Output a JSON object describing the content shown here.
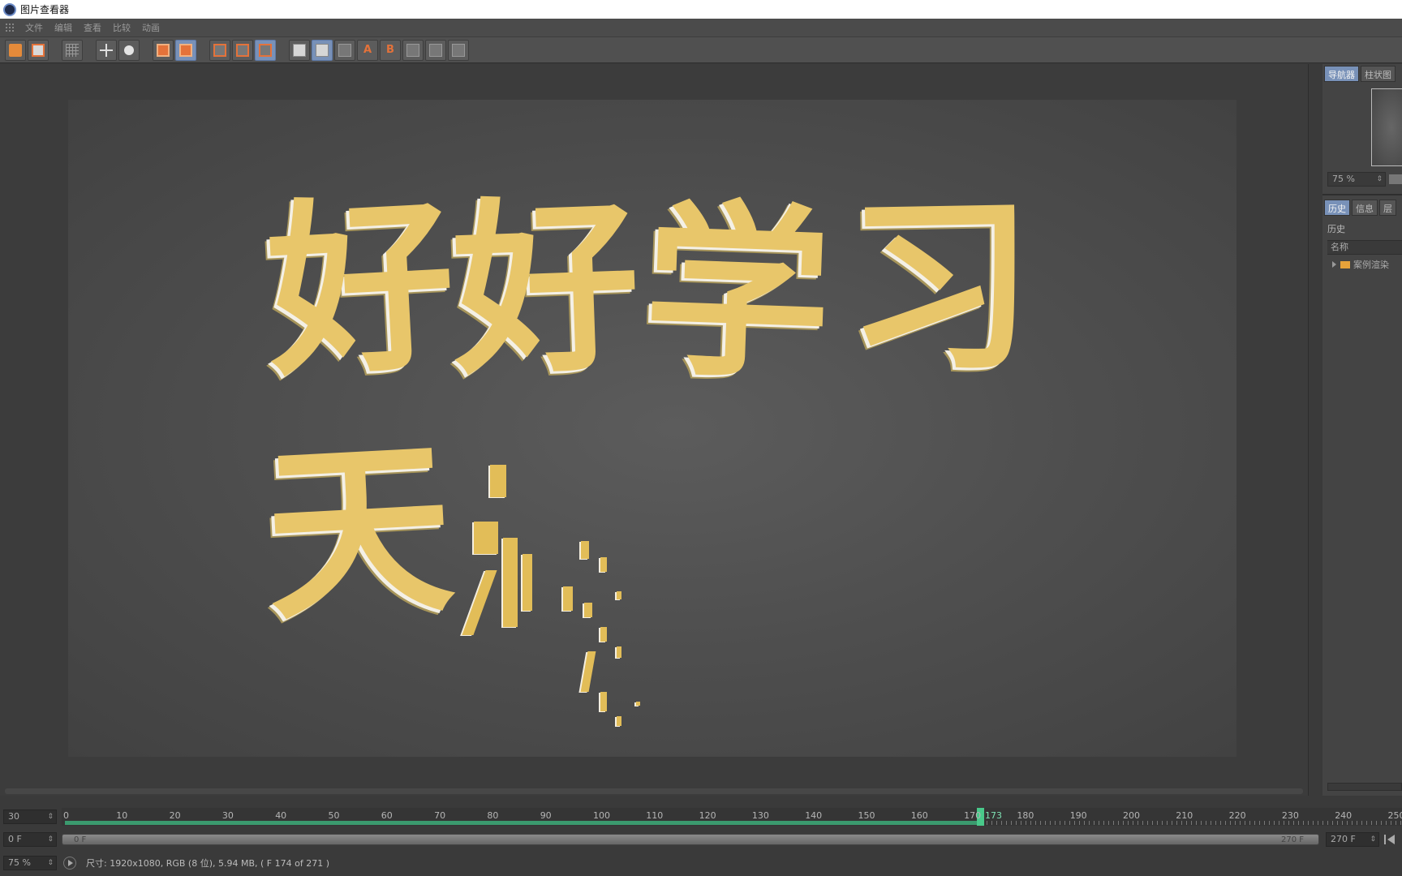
{
  "window": {
    "title": "图片查看器"
  },
  "menu": [
    "文件",
    "编辑",
    "查看",
    "比较",
    "动画"
  ],
  "canvas": {
    "text_line1": [
      "好",
      "好",
      "学",
      "习"
    ],
    "text_line2": "天",
    "text_color": "#e8c66a"
  },
  "right_panel": {
    "top_tabs": [
      "导航器",
      "柱状图"
    ],
    "zoom": "75 %",
    "bottom_tabs": [
      "历史",
      "信息",
      "层"
    ],
    "history_title": "历史",
    "column_name": "名称",
    "items": [
      "案例渲染"
    ]
  },
  "timeline": {
    "fps": "30",
    "ticks": [
      "0",
      "10",
      "20",
      "30",
      "40",
      "50",
      "60",
      "70",
      "80",
      "90",
      "100",
      "110",
      "120",
      "130",
      "140",
      "150",
      "160",
      "170",
      "180",
      "190",
      "200",
      "210",
      "220",
      "230",
      "240",
      "250"
    ],
    "playhead_frame": "173",
    "range_start": "0 F",
    "range_end": "270 F",
    "current": "0 F",
    "end": "270 F"
  },
  "status": {
    "zoom": "75 %",
    "info": "尺寸: 1920x1080, RGB (8 位), 5.94 MB, ( F 174 of 271 )"
  },
  "accent_colors": {
    "selected_tab": "#7891b8",
    "timeline_progress": "#3b9a6e",
    "icon_orange": "#e4723a"
  }
}
